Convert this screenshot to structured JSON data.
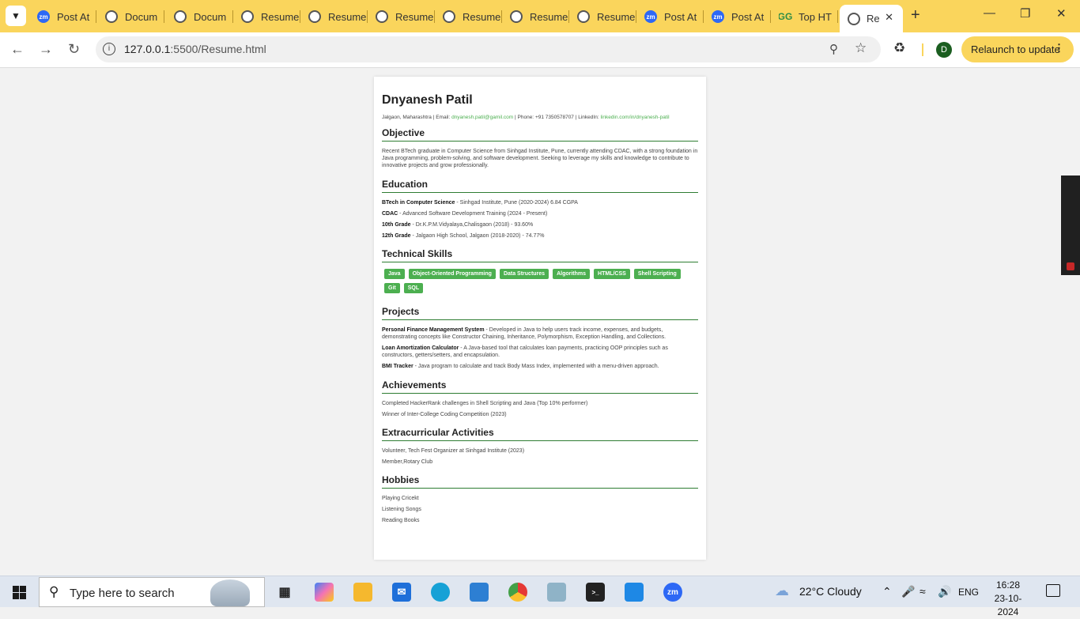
{
  "browser": {
    "tabs": [
      {
        "icon": "zoom-icon",
        "label": "Post At"
      },
      {
        "icon": "globe-icon",
        "label": "Docum"
      },
      {
        "icon": "globe-icon",
        "label": "Docum"
      },
      {
        "icon": "globe-icon",
        "label": "Resume"
      },
      {
        "icon": "globe-icon",
        "label": "Resume"
      },
      {
        "icon": "globe-icon",
        "label": "Resume"
      },
      {
        "icon": "globe-icon",
        "label": "Resume"
      },
      {
        "icon": "globe-icon",
        "label": "Resume"
      },
      {
        "icon": "globe-icon",
        "label": "Resume"
      },
      {
        "icon": "zoom-icon",
        "label": "Post At"
      },
      {
        "icon": "zoom-icon",
        "label": "Post At"
      },
      {
        "icon": "geeksforgeeks-icon",
        "label": "Top HT"
      }
    ],
    "active_tab": "Re",
    "url_host": "127.0.0.1",
    "url_path": ":5500/Resume.html",
    "profile_initial": "D",
    "relaunch_label": "Relaunch to update",
    "chrome_color": "#fad55c"
  },
  "resume": {
    "name": "Dnyanesh Patil",
    "contact": {
      "location": "Jalgaon, Maharashtra",
      "email_label": "Email:",
      "email": "dnyanesh.patil@gamil.com",
      "phone_label": "Phone:",
      "phone": "+91 7350578707",
      "linkedin_label": "LinkedIn:",
      "linkedin": "linkedin.com/in/dnyanesh-patil"
    },
    "objective": {
      "title": "Objective",
      "text": "Recent BTech graduate in Computer Science from Sinhgad Institute, Pune, currently attending CDAC, with a strong foundation in Java programming, problem-solving, and software development. Seeking to leverage my skills and knowledge to contribute to innovative projects and grow professionally."
    },
    "education": {
      "title": "Education",
      "items": [
        {
          "degree": "BTech in Computer Science",
          "detail": " - Sinhgad Institute, Pune (2020-2024) 6.84 CGPA"
        },
        {
          "degree": "CDAC",
          "detail": " - Advanced Software Development Training (2024 - Present)"
        },
        {
          "degree": "10th Grade",
          "detail": " - Dr.K.P.M.Vidyalaya,Chalisgaon (2018) - 93.60%"
        },
        {
          "degree": "12th Grade",
          "detail": " - Jalgaon High School, Jalgaon (2018-2020) - 74.77%"
        }
      ]
    },
    "skills": {
      "title": "Technical Skills",
      "items": [
        "Java",
        "Object-Oriented Programming",
        "Data Structures",
        "Algorithms",
        "HTML/CSS",
        "Shell Scripting",
        "Git",
        "SQL"
      ]
    },
    "projects": {
      "title": "Projects",
      "items": [
        {
          "name": "Personal Finance Management System",
          "desc": " - Developed in Java to help users track income, expenses, and budgets, demonstrating concepts like Constructor Chaining, Inheritance, Polymorphism, Exception Handling, and Collections."
        },
        {
          "name": "Loan Amortization Calculator",
          "desc": " - A Java-based tool that calculates loan payments, practicing OOP principles such as constructors, getters/setters, and encapsulation."
        },
        {
          "name": "BMI Tracker",
          "desc": " - Java program to calculate and track Body Mass Index, implemented with a menu-driven approach."
        }
      ]
    },
    "achievements": {
      "title": "Achievements",
      "items": [
        "Completed HackerRank challenges in Shell Scripting and Java (Top 10% performer)",
        "Winner of Inter-College Coding Competition (2023)"
      ]
    },
    "extracurricular": {
      "title": "Extracurricular Activities",
      "items": [
        "Volunteer, Tech Fest Organizer at Sinhgad Institute (2023)",
        "Member,Rotary Club"
      ]
    },
    "hobbies": {
      "title": "Hobbies",
      "items": [
        "Playing Cricekt",
        "Listening Songs",
        "Reading Books"
      ]
    },
    "accent_color": "#4caf50"
  },
  "taskbar": {
    "search_placeholder": "Type here to search",
    "weather": "22°C  Cloudy",
    "language": "ENG",
    "time": "16:28",
    "date": "23-10-2024"
  }
}
